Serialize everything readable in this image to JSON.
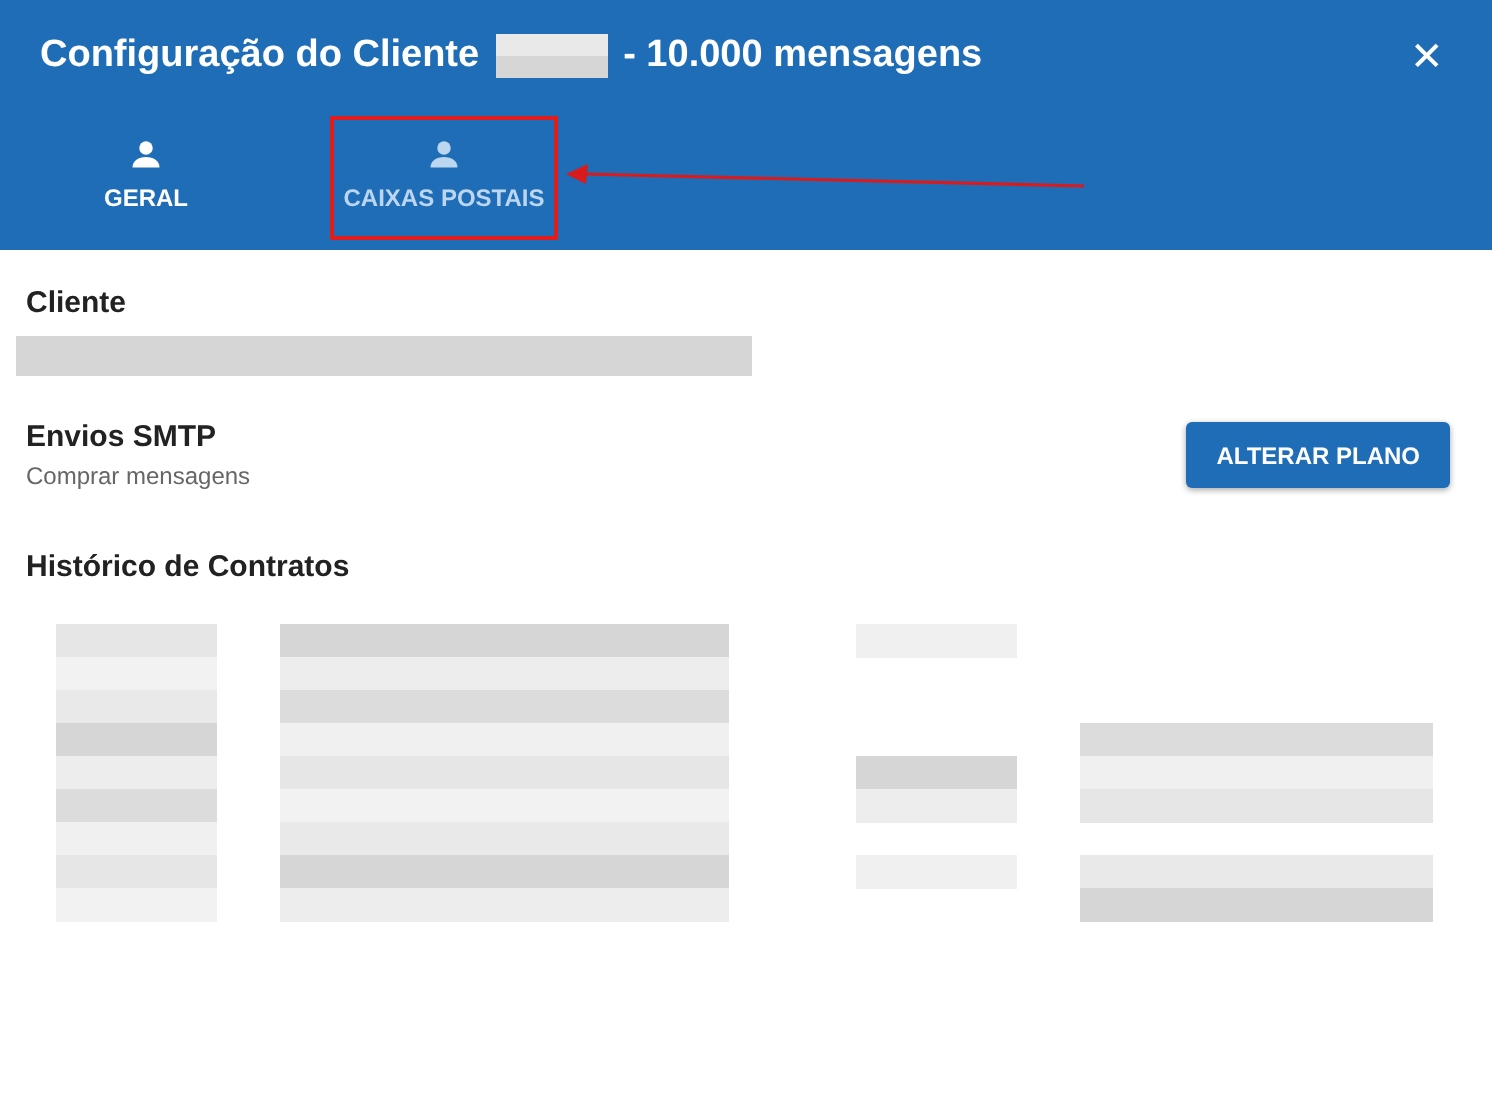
{
  "dialog": {
    "title_before": "Configuração do Cliente",
    "title_after": "- 10.000 mensagens",
    "close_label": "✕"
  },
  "tabs": [
    {
      "label": "GERAL",
      "selected": true,
      "highlighted": false
    },
    {
      "label": "CAIXAS POSTAIS",
      "selected": false,
      "highlighted": true
    }
  ],
  "client": {
    "label": "Cliente"
  },
  "smtp": {
    "title": "Envios SMTP",
    "subtitle": "Comprar mensagens",
    "button": "ALTERAR PLANO"
  },
  "history": {
    "title": "Histórico de Contratos"
  }
}
